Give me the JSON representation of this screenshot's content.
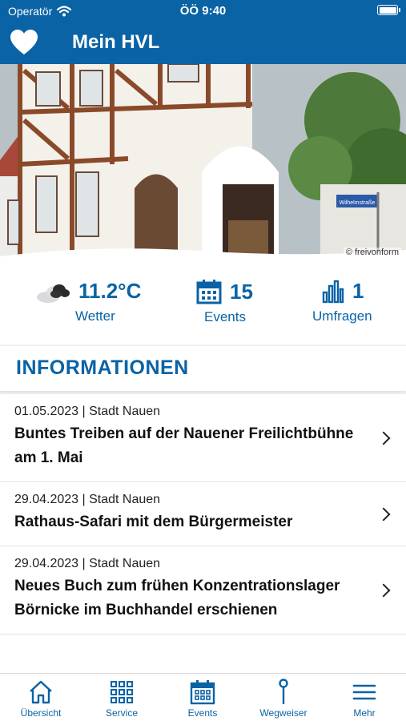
{
  "status_bar": {
    "carrier": "Operatör",
    "time": "ÖÖ 9:40"
  },
  "header": {
    "title": "Mein HVL",
    "icon": "heart-icon"
  },
  "hero": {
    "credit": "© freivonform",
    "street_sign": "Wilhelmstraße"
  },
  "stats": [
    {
      "value": "11.2°C",
      "label": "Wetter",
      "icon": "cloud-weather-icon"
    },
    {
      "value": "15",
      "label": "Events",
      "icon": "calendar-icon"
    },
    {
      "value": "1",
      "label": "Umfragen",
      "icon": "bar-chart-icon"
    }
  ],
  "section": {
    "title": "INFORMATIONEN"
  },
  "news": [
    {
      "meta": "01.05.2023 | Stadt Nauen",
      "headline": "Buntes Treiben auf der Nauener Freilichtbühne am 1. Mai"
    },
    {
      "meta": "29.04.2023 | Stadt Nauen",
      "headline": "Rathaus-Safari mit dem Bürgermeister"
    },
    {
      "meta": "29.04.2023 | Stadt Nauen",
      "headline": "Neues Buch zum frühen Konzentrationslager Börnicke im Buchhandel erschienen"
    }
  ],
  "tabs": [
    {
      "label": "Übersicht",
      "icon": "home-icon"
    },
    {
      "label": "Service",
      "icon": "grid-icon"
    },
    {
      "label": "Events",
      "icon": "calendar-icon"
    },
    {
      "label": "Wegweiser",
      "icon": "pin-icon"
    },
    {
      "label": "Mehr",
      "icon": "menu-icon"
    }
  ],
  "colors": {
    "brand": "#0a63a5",
    "background": "#f2f2f4"
  }
}
